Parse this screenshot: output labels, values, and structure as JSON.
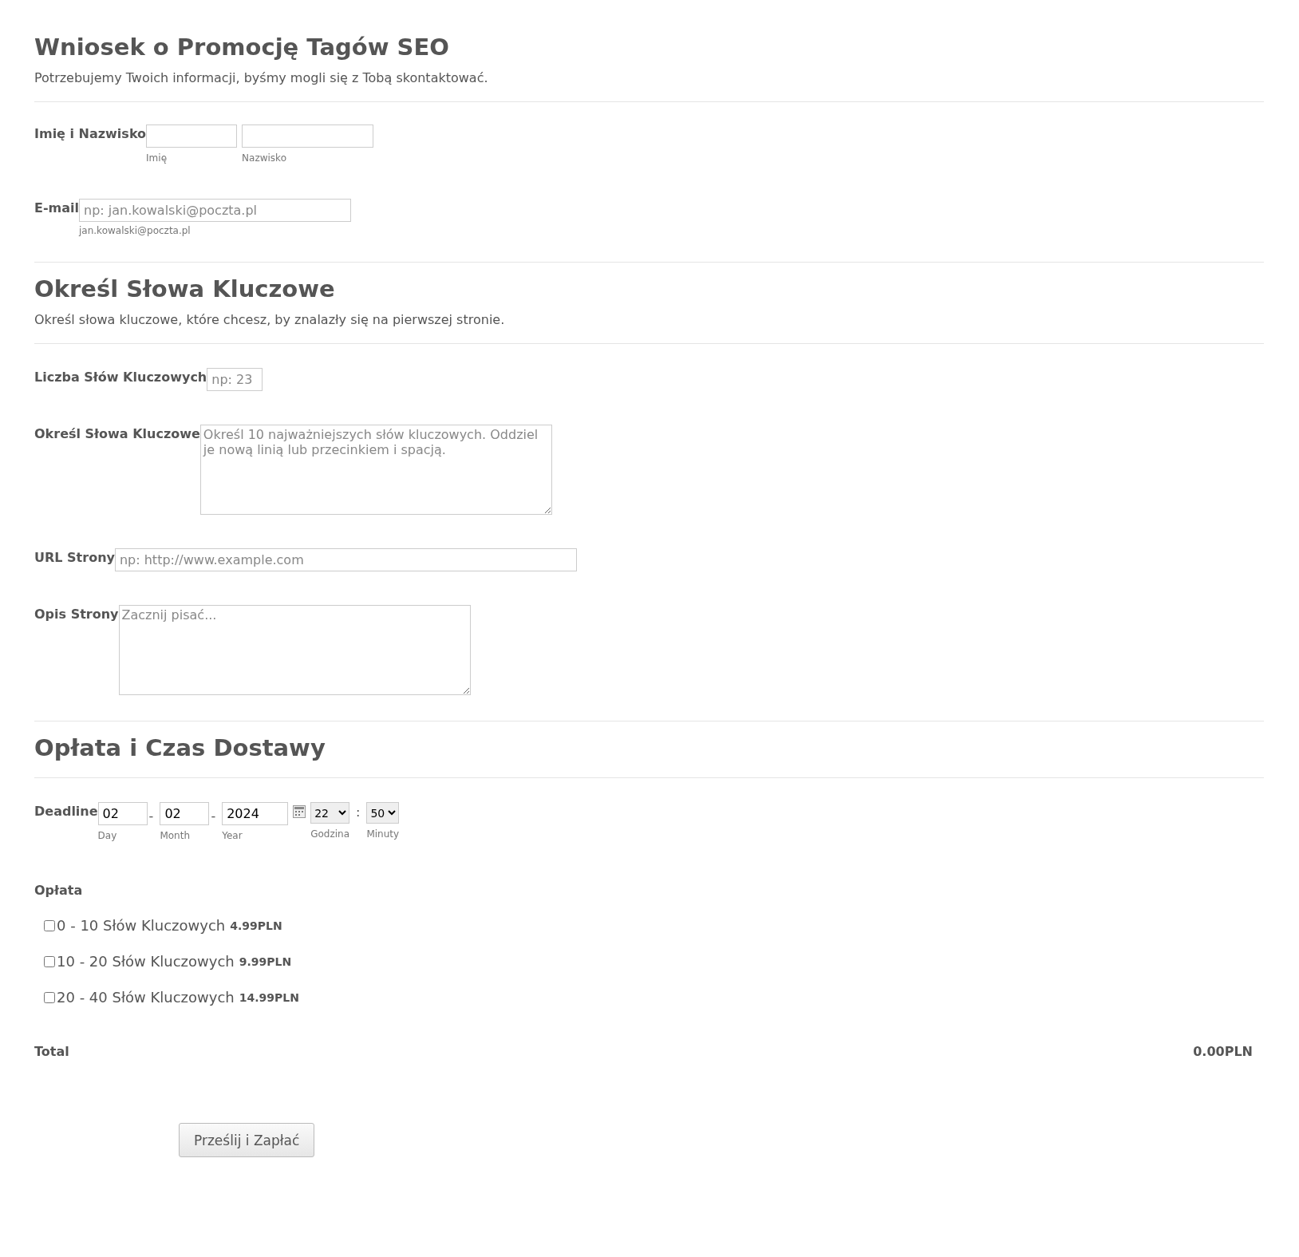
{
  "sections": [
    {
      "title": "Wniosek o Promocję Tagów SEO",
      "description": "Potrzebujemy Twoich informacji, byśmy mogli się z Tobą skontaktować.",
      "fields": [
        {
          "kind": "name",
          "label": "Imię i Nazwisko",
          "sublabels": [
            "Imię",
            "Nazwisko"
          ]
        },
        {
          "kind": "email",
          "label": "E-mail",
          "placeholder": "np: jan.kowalski@poczta.pl",
          "sublabel": "jan.kowalski@poczta.pl"
        }
      ]
    },
    {
      "title": "Określ Słowa Kluczowe",
      "description": "Określ słowa kluczowe, które chcesz, by znalazły się na pierwszej stronie.",
      "fields": [
        {
          "kind": "number",
          "label": "Liczba Słów Kluczowych",
          "placeholder": "np: 23"
        },
        {
          "kind": "textarea",
          "label": "Określ Słowa Kluczowe",
          "placeholder": "Określ 10 najważniejszych słów kluczowych. Oddziel je nową linią lub przecinkiem i spacją."
        },
        {
          "kind": "url",
          "label": "URL Strony",
          "placeholder": "np: http://www.example.com"
        },
        {
          "kind": "textarea",
          "label": "Opis Strony",
          "placeholder": "Zacznij pisać..."
        }
      ]
    },
    {
      "title": "Opłata i Czas Dostawy",
      "fields": [
        {
          "kind": "date",
          "label": "Deadline",
          "day": "02",
          "month": "02",
          "year": "2024",
          "separator": "-",
          "day_label": "Day",
          "month_label": "Month",
          "year_label": "Year",
          "hour": "22",
          "hour_label": "Godzina",
          "time_separator": ":",
          "minute": "50",
          "minute_label": "Minuty"
        },
        {
          "kind": "payment",
          "label": "Opłata",
          "options": [
            {
              "label": "0 - 10 Słów Kluczowych",
              "price": "4.99PLN",
              "checked": false
            },
            {
              "label": "10 - 20 Słów Kluczowych",
              "price": "9.99PLN",
              "checked": false
            },
            {
              "label": "20 - 40 Słów Kluczowych",
              "price": "14.99PLN",
              "checked": false
            }
          ]
        },
        {
          "kind": "total",
          "label": "Total",
          "value": "0.00PLN"
        }
      ]
    }
  ],
  "submit": "Prześlij i Zapłać"
}
